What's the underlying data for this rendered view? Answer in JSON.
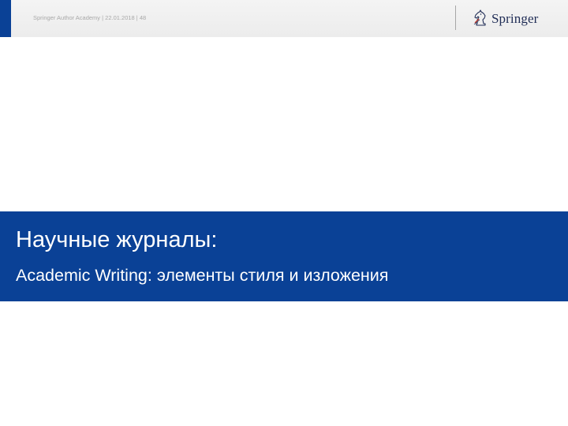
{
  "header": {
    "footer_line": "Springer Author Academy | 22.01.2018 | 48",
    "logo_text": "Springer",
    "logo_icon": "springer-horse-icon"
  },
  "title_slide": {
    "title": "Научные журналы:",
    "subtitle": "Academic Writing: элементы стиля и изложения"
  },
  "colors": {
    "brand_blue": "#0a4196",
    "header_bg": "#efefef",
    "header_text": "#a9a9a9",
    "logo_text": "#1f2c55"
  }
}
